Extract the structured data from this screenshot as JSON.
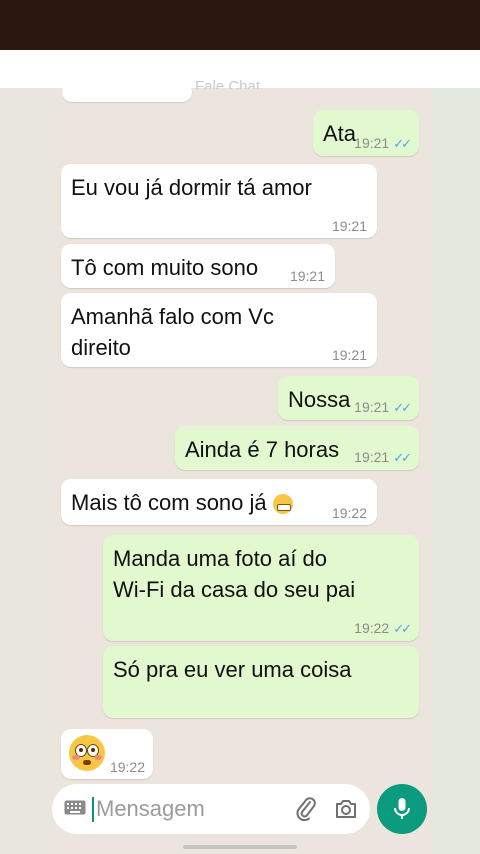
{
  "chat": {
    "header_partial": "Fale Chat",
    "messages": [
      {
        "dir": "out",
        "text": "Ata",
        "time": "19:21",
        "read": true
      },
      {
        "dir": "in",
        "text": "Eu vou já dormir tá amor",
        "time": "19:21"
      },
      {
        "dir": "in",
        "text": "Tô com muito sono",
        "time": "19:21"
      },
      {
        "dir": "in",
        "text_line1": "Amanhã falo com Vc",
        "text_line2": "direito",
        "time": "19:21"
      },
      {
        "dir": "out",
        "text": "Nossa",
        "time": "19:21",
        "read": true
      },
      {
        "dir": "out",
        "text": "Ainda é 7 horas",
        "time": "19:21",
        "read": true
      },
      {
        "dir": "in",
        "text": "Mais tô com sono já",
        "emoji": "grimacing-face",
        "time": "19:22"
      },
      {
        "dir": "out",
        "text_line1": "Manda uma foto aí do",
        "text_line2": "Wi-Fi da casa do seu pai",
        "time": "19:22",
        "read": true
      },
      {
        "dir": "out",
        "text": "Só pra eu ver uma coisa",
        "time": ""
      },
      {
        "dir": "in",
        "emoji": "flushed-face",
        "time": "19:22"
      }
    ]
  },
  "composer": {
    "placeholder": "Mensagem",
    "icons": [
      "keyboard-icon",
      "attach-icon",
      "camera-icon",
      "mic-icon"
    ]
  },
  "colors": {
    "incoming": "#ffffff",
    "outgoing": "#e2f8cf",
    "read_check": "#4fa7e6",
    "mic_button": "#0c9b7f"
  }
}
